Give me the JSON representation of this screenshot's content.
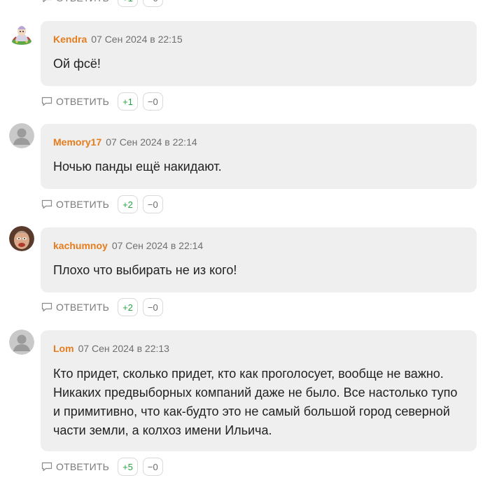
{
  "reply_label": "ОТВЕТИТЬ",
  "colors": {
    "author": "#e57c1e",
    "upvote": "#27a344",
    "bubble": "#efefef"
  },
  "top_partial": {
    "plus": "+1",
    "minus": "−0"
  },
  "comments": [
    {
      "author": "Kendra",
      "date": "07 Сен 2024 в 22:15",
      "text": "Ой фсё!",
      "plus": "+1",
      "minus": "−0",
      "avatar": "cartoon-character-avatar"
    },
    {
      "author": "Memory17",
      "date": "07 Сен 2024 в 22:14",
      "text": "Ночью панды ещё накидают.",
      "plus": "+2",
      "minus": "−0",
      "avatar": "default-user-avatar"
    },
    {
      "author": "kachumnoy",
      "date": "07 Сен 2024 в 22:14",
      "text": "Плохо что выбирать не из кого!",
      "plus": "+2",
      "minus": "−0",
      "avatar": "photo-user-avatar"
    },
    {
      "author": "Lom",
      "date": "07 Сен 2024 в 22:13",
      "text": "Кто придет, сколько придет, кто как проголосует, вообще не важно. Никаких предвыборных компаний даже не было. Все настолько тупо и примитивно, что как-будто это не самый большой город северной части земли, а колхоз имени Ильича.",
      "plus": "+5",
      "minus": "−0",
      "avatar": "default-user-avatar"
    }
  ]
}
